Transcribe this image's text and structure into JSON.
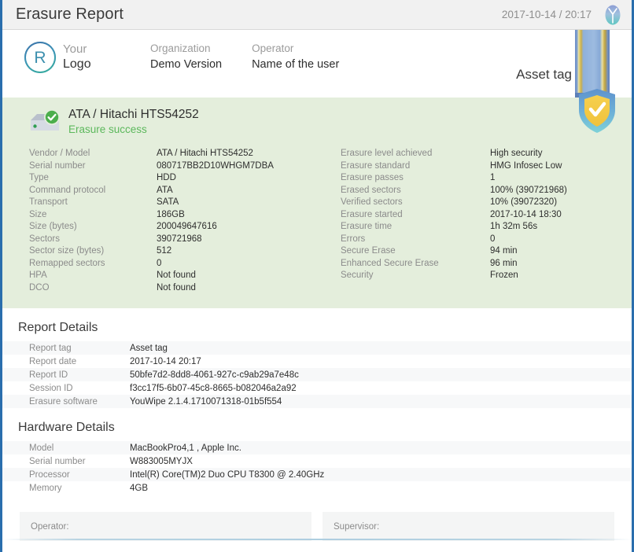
{
  "window": {
    "title": "Erasure Report",
    "datetime": "2017-10-14 / 20:17",
    "app_logo_icon": "tree-leaf-logo-icon"
  },
  "header": {
    "logo": {
      "letter": "R",
      "line1": "Your",
      "line2": "Logo"
    },
    "organization": {
      "label": "Organization",
      "value": "Demo Version"
    },
    "operator": {
      "label": "Operator",
      "value": "Name of the user"
    },
    "asset_tag": "Asset tag",
    "ribbon_icon": "ribbon-banner-icon",
    "shield_icon": "shield-check-icon"
  },
  "drive": {
    "icon": "hard-drive-success-icon",
    "title": "ATA / Hitachi HTS54252",
    "status": "Erasure success",
    "left_rows": [
      {
        "key": "Vendor / Model",
        "value": "ATA / Hitachi HTS54252"
      },
      {
        "key": "Serial number",
        "value": "080717BB2D10WHGM7DBA"
      },
      {
        "key": "Type",
        "value": "HDD"
      },
      {
        "key": "Command protocol",
        "value": "ATA"
      },
      {
        "key": "Transport",
        "value": "SATA"
      },
      {
        "key": "Size",
        "value": "186GB"
      },
      {
        "key": "Size (bytes)",
        "value": "200049647616"
      },
      {
        "key": "Sectors",
        "value": "390721968"
      },
      {
        "key": "Sector size (bytes)",
        "value": "512"
      },
      {
        "key": "Remapped sectors",
        "value": "0"
      },
      {
        "key": "HPA",
        "value": "Not found"
      },
      {
        "key": "DCO",
        "value": "Not found"
      }
    ],
    "right_rows": [
      {
        "key": "Erasure level achieved",
        "value": "High security"
      },
      {
        "key": "Erasure standard",
        "value": "HMG Infosec Low"
      },
      {
        "key": "Erasure passes",
        "value": "1"
      },
      {
        "key": "Erased sectors",
        "value": "100% (390721968)"
      },
      {
        "key": "Verified sectors",
        "value": "10% (39072320)"
      },
      {
        "key": "Erasure started",
        "value": "2017-10-14 18:30"
      },
      {
        "key": "Erasure time",
        "value": "1h 32m 56s"
      },
      {
        "key": "Errors",
        "value": "0"
      },
      {
        "key": "Secure Erase",
        "value": "94 min"
      },
      {
        "key": "Enhanced Secure Erase",
        "value": "96 min"
      },
      {
        "key": "Security",
        "value": "Frozen"
      }
    ]
  },
  "report_details": {
    "title": "Report Details",
    "rows": [
      {
        "key": "Report tag",
        "value": "Asset tag"
      },
      {
        "key": "Report date",
        "value": "2017-10-14 20:17"
      },
      {
        "key": "Report ID",
        "value": "50bfe7d2-8dd8-4061-927c-c9ab29a7e48c"
      },
      {
        "key": "Session ID",
        "value": "f3cc17f5-6b07-45c8-8665-b082046a2a92"
      },
      {
        "key": "Erasure software",
        "value": "YouWipe 2.1.4.1710071318-01b5f554"
      }
    ]
  },
  "hardware_details": {
    "title": "Hardware Details",
    "rows": [
      {
        "key": "Model",
        "value": "MacBookPro4,1 , Apple Inc."
      },
      {
        "key": "Serial number",
        "value": "W883005MYJX"
      },
      {
        "key": "Processor",
        "value": "Intel(R) Core(TM)2 Duo CPU T8300 @ 2.40GHz"
      },
      {
        "key": "Memory",
        "value": "4GB"
      }
    ]
  },
  "signatures": {
    "operator_label": "Operator:",
    "supervisor_label": "Supervisor:"
  },
  "colors": {
    "window_border": "#2a6ead",
    "titlebar_bg": "#f1f1f1",
    "drive_panel_bg": "#e4eedc",
    "success_green": "#5cb85c",
    "row_stripe": "#f7f8f9",
    "label_gray": "#8b8b8b",
    "value_dark": "#2e2e2e"
  }
}
